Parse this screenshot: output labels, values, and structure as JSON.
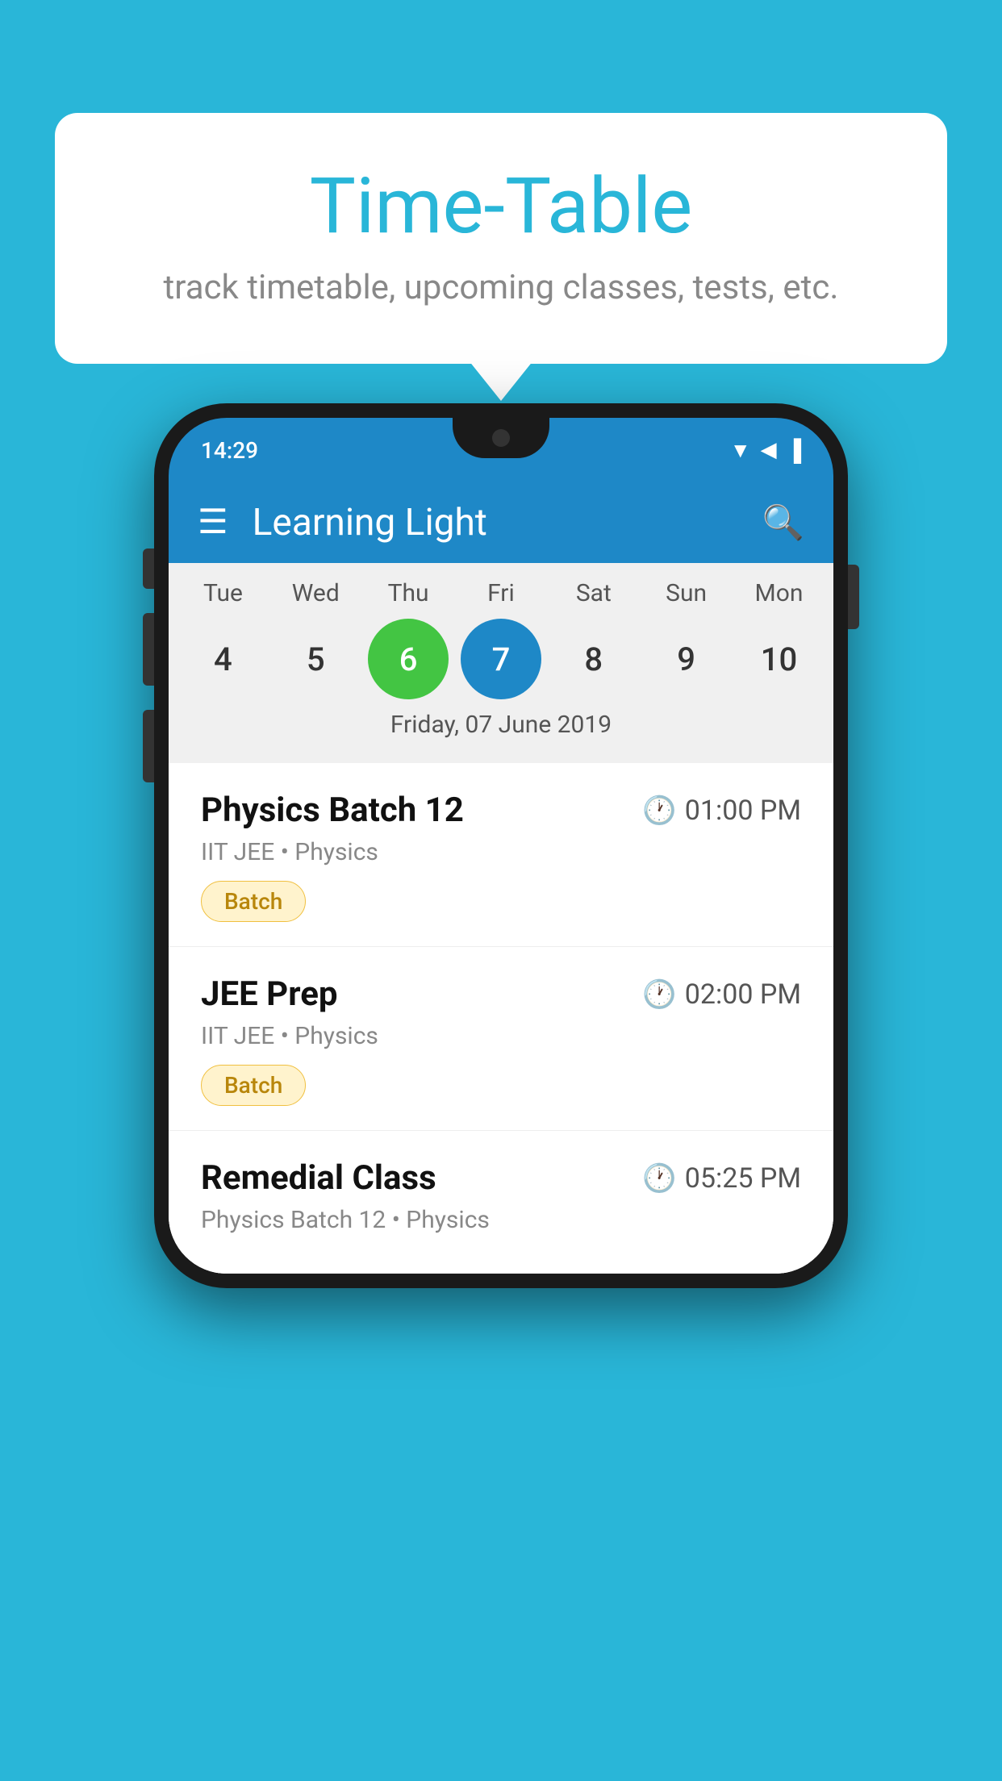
{
  "background": {
    "color": "#29B6D8"
  },
  "tooltip": {
    "title": "Time-Table",
    "subtitle": "track timetable, upcoming classes, tests, etc."
  },
  "phone": {
    "status_time": "14:29",
    "toolbar_title": "Learning Light",
    "calendar": {
      "days": [
        {
          "name": "Tue",
          "num": "4",
          "state": "normal"
        },
        {
          "name": "Wed",
          "num": "5",
          "state": "normal"
        },
        {
          "name": "Thu",
          "num": "6",
          "state": "today"
        },
        {
          "name": "Fri",
          "num": "7",
          "state": "selected"
        },
        {
          "name": "Sat",
          "num": "8",
          "state": "normal"
        },
        {
          "name": "Sun",
          "num": "9",
          "state": "normal"
        },
        {
          "name": "Mon",
          "num": "10",
          "state": "normal"
        }
      ],
      "selected_date_label": "Friday, 07 June 2019"
    },
    "schedule": [
      {
        "title": "Physics Batch 12",
        "time": "01:00 PM",
        "subtitle": "IIT JEE • Physics",
        "badge": "Batch"
      },
      {
        "title": "JEE Prep",
        "time": "02:00 PM",
        "subtitle": "IIT JEE • Physics",
        "badge": "Batch"
      },
      {
        "title": "Remedial Class",
        "time": "05:25 PM",
        "subtitle": "Physics Batch 12 • Physics",
        "badge": null
      }
    ]
  }
}
